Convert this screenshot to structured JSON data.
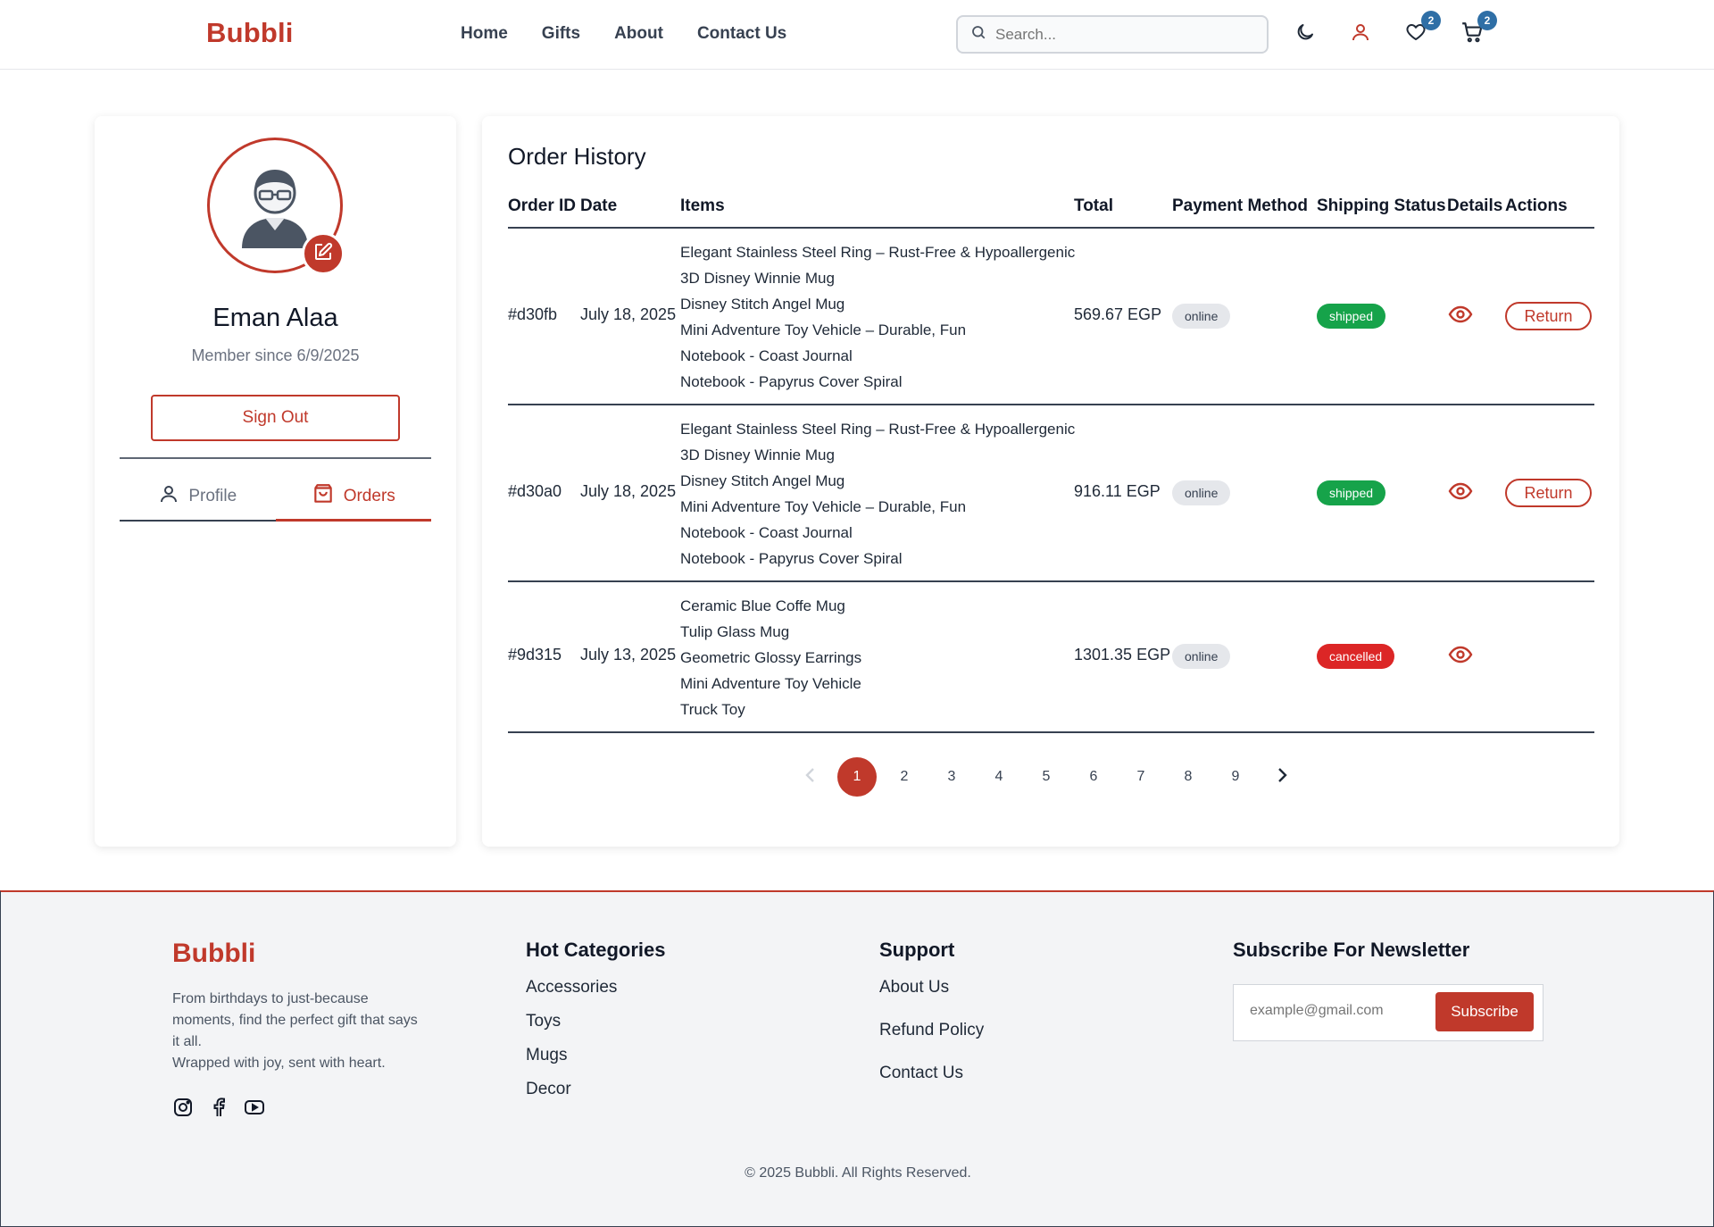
{
  "brand": "Bubbli",
  "nav": [
    "Home",
    "Gifts",
    "About",
    "Contact Us"
  ],
  "search": {
    "placeholder": "Search..."
  },
  "header_icons": {
    "wishlist_count": "2",
    "cart_count": "2"
  },
  "profile": {
    "name": "Eman Alaa",
    "member_since": "Member since 6/9/2025",
    "sign_out": "Sign Out",
    "tabs": [
      "Profile",
      "Orders"
    ]
  },
  "orders": {
    "title": "Order History",
    "columns": [
      "Order ID",
      "Date",
      "Items",
      "Total",
      "Payment Method",
      "Shipping Status",
      "Details",
      "Actions"
    ],
    "rows": [
      {
        "id": "#d30fb",
        "date": "July 18, 2025",
        "items": [
          "Elegant Stainless Steel Ring – Rust-Free & Hypoallergenic",
          "3D Disney Winnie Mug",
          "Disney Stitch Angel Mug",
          "Mini Adventure Toy Vehicle – Durable, Fun",
          "Notebook - Coast Journal",
          "Notebook - Papyrus Cover Spiral"
        ],
        "total": "569.67 EGP",
        "method": "online",
        "status": "shipped",
        "action": "Return"
      },
      {
        "id": "#d30a0",
        "date": "July 18, 2025",
        "items": [
          "Elegant Stainless Steel Ring – Rust-Free & Hypoallergenic",
          "3D Disney Winnie Mug",
          "Disney Stitch Angel Mug",
          "Mini Adventure Toy Vehicle – Durable, Fun",
          "Notebook - Coast Journal",
          "Notebook - Papyrus Cover Spiral"
        ],
        "total": "916.11 EGP",
        "method": "online",
        "status": "shipped",
        "action": "Return"
      },
      {
        "id": "#9d315",
        "date": "July 13, 2025",
        "items": [
          "Ceramic Blue Coffe Mug",
          "Tulip Glass Mug",
          "Geometric Glossy Earrings",
          "Mini Adventure Toy Vehicle",
          "Truck Toy"
        ],
        "total": "1301.35 EGP",
        "method": "online",
        "status": "cancelled",
        "action": ""
      }
    ],
    "pagination": {
      "pages": [
        "1",
        "2",
        "3",
        "4",
        "5",
        "6",
        "7",
        "8",
        "9"
      ],
      "current": "1"
    }
  },
  "footer": {
    "brand": "Bubbli",
    "desc_line1": "From birthdays to just-because moments, find the perfect gift that says it all.",
    "desc_line2": "Wrapped with joy, sent with heart.",
    "hot_title": "Hot Categories",
    "hot": [
      "Accessories",
      "Toys",
      "Mugs",
      "Decor"
    ],
    "support_title": "Support",
    "support": [
      "About Us",
      "Refund Policy",
      "Contact Us"
    ],
    "newsletter_title": "Subscribe For Newsletter",
    "newsletter_placeholder": "example@gmail.com",
    "subscribe": "Subscribe",
    "copyright": "© 2025 Bubbli. All Rights Reserved."
  },
  "colors": {
    "accent": "#c0392b",
    "shipped": "#16a34a",
    "cancelled": "#dc2626",
    "badge": "#2f6fa6"
  }
}
